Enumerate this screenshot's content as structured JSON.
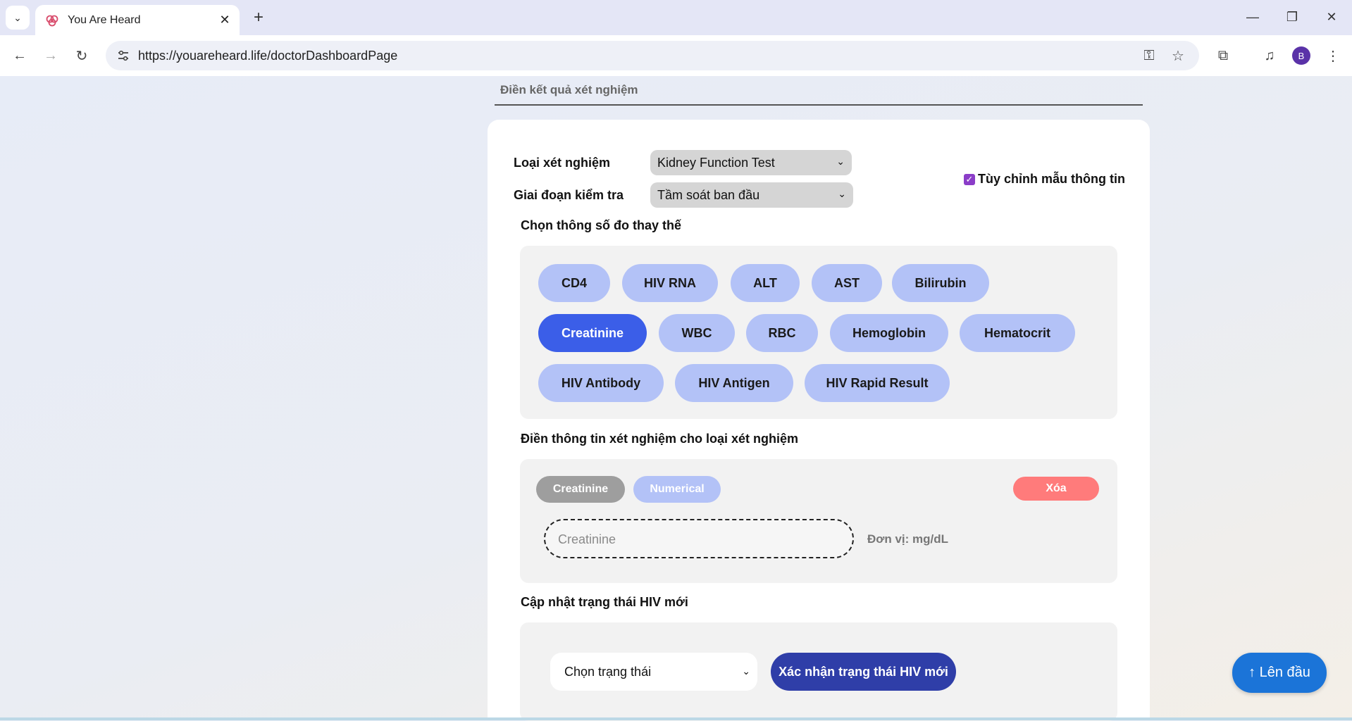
{
  "browser": {
    "tab_title": "You Are Heard",
    "url": "https://youareheard.life/doctorDashboardPage",
    "avatar_letter": "B"
  },
  "section": {
    "heading": "Điền kết quả xét nghiệm"
  },
  "form": {
    "test_type_label": "Loại xét nghiệm",
    "test_type_value": "Kidney Function Test",
    "stage_label": "Giai đoạn kiểm tra",
    "stage_value": "Tầm soát ban đầu",
    "customize_label": "Tùy chỉnh mẫu thông tin",
    "customize_checked": true
  },
  "params": {
    "heading": "Chọn thông số đo thay thế",
    "chips": [
      "CD4",
      "HIV RNA",
      "ALT",
      "AST",
      "Bilirubin",
      "Creatinine",
      "WBC",
      "RBC",
      "Hemoglobin",
      "Hematocrit",
      "HIV Antibody",
      "HIV Antigen",
      "HIV Rapid Result"
    ],
    "selected": "Creatinine"
  },
  "entry": {
    "heading": "Điền thông tin xét nghiệm cho loại xét nghiệm",
    "param_tag": "Creatinine",
    "type_tag": "Numerical",
    "delete_label": "Xóa",
    "input_placeholder": "Creatinine",
    "unit_label": "Đơn vị: mg/dL"
  },
  "hiv": {
    "heading": "Cập nhật trạng thái HIV mới",
    "status_placeholder": "Chọn trạng thái",
    "confirm_label": "Xác nhận trạng thái HIV mới"
  },
  "back_to_top": "↑ Lên đầu",
  "colors": {
    "chip": "#b3c2f7",
    "chip_active": "#3b5ee8",
    "delete": "#ff7b7b",
    "confirm": "#2f3ea8",
    "top_button": "#1b74d8"
  }
}
